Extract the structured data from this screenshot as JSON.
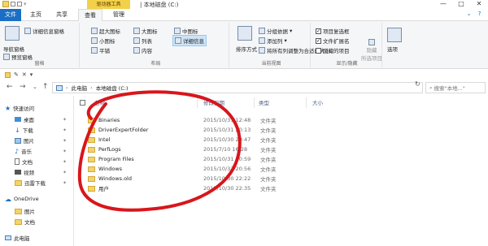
{
  "window": {
    "title_text": "| 本地磁盘 (C:)",
    "manage_tools_label": "驱动器工具",
    "minimize": "—",
    "maximize": "□",
    "close": "✕"
  },
  "tabs": [
    "文件",
    "主页",
    "共享",
    "查看",
    "管理"
  ],
  "ribbon": {
    "panes": {
      "label": "窗格",
      "nav_pane": "导航窗格",
      "preview_pane": "预览窗格",
      "details_pane": "详细信息窗格"
    },
    "layout": {
      "label": "布局",
      "items": [
        "超大图标",
        "大图标",
        "中图标",
        "小图标",
        "列表",
        "详细信息",
        "平铺",
        "内容"
      ]
    },
    "current_view": {
      "label": "当前视图",
      "sort_by": "排序方式",
      "group_by": "分组依据",
      "add_columns": "添加列",
      "size_all_columns": "将所有列调整为合适的大小"
    },
    "show_hide": {
      "label": "显示/隐藏",
      "item_checkboxes": "项目复选框",
      "file_extensions": "文件扩展名",
      "hidden_items": "隐藏的项目",
      "hide_selected": "隐藏",
      "hide_selected_sub": "所选项目"
    },
    "options": "选项"
  },
  "address": {
    "pc": "此电脑",
    "drive": "本地磁盘 (C:)",
    "search_placeholder": "搜索\"本地...\""
  },
  "nav_pane": {
    "items": [
      {
        "label": "快速访问"
      },
      {
        "label": "桌面"
      },
      {
        "label": "下载"
      },
      {
        "label": "图片"
      },
      {
        "label": "音乐"
      },
      {
        "label": "文档"
      },
      {
        "label": "视频"
      },
      {
        "label": "迅雷下载"
      },
      {
        "label": "OneDrive"
      },
      {
        "label": "图片"
      },
      {
        "label": "文档"
      },
      {
        "label": "此电脑"
      }
    ]
  },
  "columns": {
    "name": "名称",
    "date": "修改日期",
    "type": "类型",
    "size": "大小"
  },
  "files": [
    {
      "name": "Binaries",
      "date": "2015/10/31 12:48",
      "type": "文件夹"
    },
    {
      "name": "DriverExpertFolder",
      "date": "2015/10/31 20:13",
      "type": "文件夹"
    },
    {
      "name": "Intel",
      "date": "2015/10/30 20:47",
      "type": "文件夹"
    },
    {
      "name": "PerfLogs",
      "date": "2015/7/10 16:28",
      "type": "文件夹"
    },
    {
      "name": "Program Files",
      "date": "2015/10/31 20:59",
      "type": "文件夹"
    },
    {
      "name": "Windows",
      "date": "2015/10/31 20:56",
      "type": "文件夹"
    },
    {
      "name": "Windows.old",
      "date": "2015/10/30 22:22",
      "type": "文件夹"
    },
    {
      "name": "用户",
      "date": "2015/10/30 22:35",
      "type": "文件夹"
    }
  ],
  "annotation_color": "#d8161c",
  "accent_color": "#1a6fc4"
}
